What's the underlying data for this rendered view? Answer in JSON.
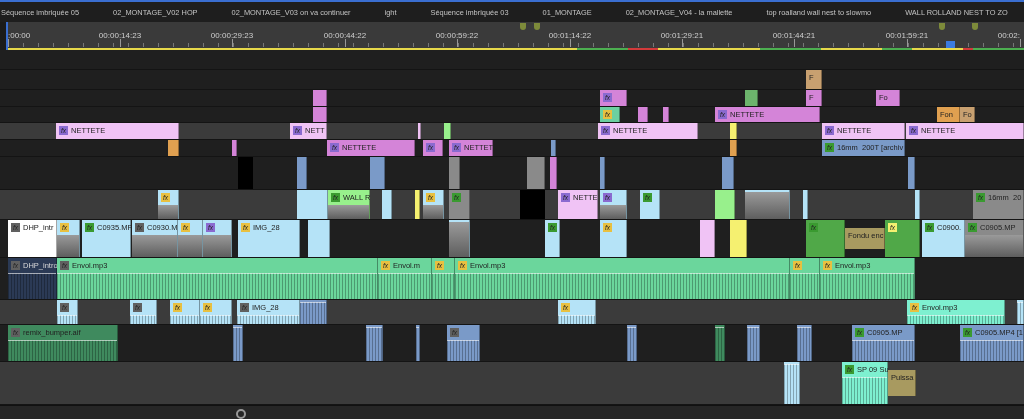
{
  "tabs": [
    {
      "label": "Séquence imbriquée 05",
      "selected": false
    },
    {
      "label": "02_MONTAGE_V02 HOP",
      "selected": false
    },
    {
      "label": "02_MONTAGE_V03 on va continuer",
      "selected": false
    },
    {
      "label": "ight",
      "selected": false
    },
    {
      "label": "Séquence imbriquée 03",
      "selected": false
    },
    {
      "label": "01_MONTAGE",
      "selected": false
    },
    {
      "label": "02_MONTAGE_V04 - la mallette",
      "selected": false
    },
    {
      "label": "top roalland wall nest to slowmo",
      "selected": false
    },
    {
      "label": "WALL ROLLAND NEST TO ZO",
      "selected": false
    }
  ],
  "ruler": {
    "ticks": [
      ":00:00",
      "00:00:14:23",
      "00:00:29:23",
      "00:00:44:22",
      "00:00:59:22",
      "00:01:14:22",
      "00:01:29:21",
      "00:01:44:21",
      "00:01:59:21",
      "00:02:"
    ]
  },
  "tracks": [
    {
      "highlighted": false
    },
    {
      "highlighted": false,
      "clips": [
        {
          "color": "#c8a070",
          "label": "F"
        }
      ]
    },
    {
      "highlighted": false,
      "clips": [
        {
          "color": "#d484d8"
        },
        {
          "color": "#d484d8",
          "badge": {
            "text": "fx",
            "color": "#8a6ad0"
          }
        },
        {
          "color": "#6cb46c"
        },
        {
          "color": "#d484d8",
          "label": "F"
        },
        {
          "color": "#d484d8",
          "label": "Fo"
        }
      ]
    },
    {
      "highlighted": false,
      "clips": [
        {
          "color": "#d484d8"
        },
        {
          "color": "#6cd0a0",
          "badge": {
            "text": "fx",
            "color": "#e8c040"
          }
        },
        {
          "color": "#d484d8"
        },
        {
          "color": "#d484d8"
        },
        {
          "color": "#d484d8",
          "label": "NETTETE",
          "badge": {
            "text": "fx",
            "color": "#8a6ad0"
          }
        },
        {
          "color": "#e0a050",
          "label": "Fon"
        },
        {
          "color": "#c8a070",
          "label": "Fo"
        }
      ]
    },
    {
      "highlighted": true,
      "clips": [
        {
          "color": "#f0c3f5",
          "label": "NETTETE",
          "badge": {
            "text": "fx",
            "color": "#8a6ad0"
          }
        },
        {
          "color": "#f0c3f5",
          "label": "NETT",
          "badge": {
            "text": "fx",
            "color": "#8a6ad0"
          }
        },
        {
          "color": "#f0c3f5"
        },
        {
          "color": "#98f08c"
        },
        {
          "color": "#f0c3f5",
          "label": "NETTETE",
          "badge": {
            "text": "fx",
            "color": "#8a6ad0"
          }
        },
        {
          "color": "#f5f070"
        },
        {
          "color": "#f0c3f5",
          "label": "NETTETE",
          "badge": {
            "text": "fx",
            "color": "#8a6ad0"
          }
        },
        {
          "color": "#f0c3f5",
          "label": "NETTETE",
          "badge": {
            "text": "fx",
            "color": "#8a6ad0"
          }
        }
      ]
    },
    {
      "highlighted": false,
      "clips": [
        {
          "color": "#e0a050"
        },
        {
          "color": "#d484d8"
        },
        {
          "color": "#d484d8",
          "label": "NETTETE",
          "badge": {
            "text": "fx",
            "color": "#8a6ad0"
          }
        },
        {
          "color": "#d484d8",
          "badge": {
            "text": "fx",
            "color": "#8a6ad0"
          }
        },
        {
          "color": "#d484d8",
          "label": "NETTET",
          "badge": {
            "text": "fx",
            "color": "#8a6ad0"
          }
        },
        {
          "color": "#7a9ac8"
        },
        {
          "color": "#e0a050"
        },
        {
          "color": "#7a9ac8",
          "label": "16mm  200T [archiv",
          "badge": {
            "text": "fx",
            "color": "#3a9a30"
          }
        }
      ]
    },
    {
      "highlighted": false,
      "clips": [
        {
          "color": "#000000"
        },
        {
          "color": "#7a9ac8"
        },
        {
          "color": "#7a9ac8"
        },
        {
          "color": "#8a8a8a"
        },
        {
          "color": "#8a8a8a"
        },
        {
          "color": "#d484d8"
        },
        {
          "color": "#7a9ac8"
        },
        {
          "color": "#7a9ac8"
        },
        {
          "color": "#7a9ac8"
        }
      ]
    },
    {
      "highlighted": true,
      "clips": [
        {
          "color": "#b5e3f7",
          "badge": {
            "text": "fx",
            "color": "#e8c040"
          },
          "kind": "thumb"
        },
        {
          "color": "#b5e3f7"
        },
        {
          "color": "#98f08c",
          "label": "WALL R",
          "badge": {
            "text": "fx",
            "color": "#3a9a30"
          },
          "kind": "thumb"
        },
        {
          "color": "#b5e3f7"
        },
        {
          "color": "#f5f070"
        },
        {
          "color": "#b5e3f7",
          "badge": {
            "text": "fx",
            "color": "#e8c040"
          },
          "kind": "thumb"
        },
        {
          "color": "#8a8a8a",
          "badge": {
            "text": "fx",
            "color": "#3a9a30"
          }
        },
        {
          "color": "#000000"
        },
        {
          "color": "#f0c3f5",
          "label": "NETTE",
          "badge": {
            "text": "fx",
            "color": "#8a6ad0"
          }
        },
        {
          "color": "#b5e3f7",
          "badge": {
            "text": "fx",
            "color": "#8a6ad0"
          },
          "kind": "thumb"
        },
        {
          "color": "#b5e3f7",
          "badge": {
            "text": "fx",
            "color": "#3a9a30"
          }
        },
        {
          "color": "#98f08c"
        },
        {
          "color": "#b5e3f7",
          "kind": "thumb"
        },
        {
          "color": "#b5e3f7"
        },
        {
          "color": "#b5e3f7"
        },
        {
          "color": "#8a8a8a",
          "label": "16mm  20",
          "badge": {
            "text": "fx",
            "color": "#3a9a30"
          }
        }
      ]
    },
    {
      "highlighted": false,
      "clips": [
        {
          "color": "#ffffff",
          "label": "DHP_intr",
          "badge": {
            "text": "fx",
            "color": "#606060"
          }
        },
        {
          "color": "#b5e3f7",
          "badge": {
            "text": "fx",
            "color": "#e8c040"
          },
          "kind": "thumb"
        },
        {
          "color": "#b5e3f7",
          "label": "C0935.MP",
          "badge": {
            "text": "fx",
            "color": "#3a9a30"
          }
        },
        {
          "color": "#b5e3f7",
          "label": "C0930.M",
          "badge": {
            "text": "fx",
            "color": "#606060"
          },
          "kind": "thumb"
        },
        {
          "color": "#b5e3f7",
          "badge": {
            "text": "fx",
            "color": "#e8c040"
          },
          "kind": "thumb"
        },
        {
          "color": "#b5e3f7",
          "badge": {
            "text": "fx",
            "color": "#8a6ad0"
          },
          "kind": "thumb"
        },
        {
          "color": "#b5e3f7",
          "label": "IMG_28",
          "badge": {
            "text": "fx",
            "color": "#e8c040"
          }
        },
        {
          "color": "#b5e3f7"
        },
        {
          "color": "#b5e3f7",
          "kind": "thumb"
        },
        {
          "color": "#b5e3f7",
          "badge": {
            "text": "fx",
            "color": "#3a9a30"
          }
        },
        {
          "color": "#b5e3f7",
          "badge": {
            "text": "fx",
            "color": "#e8c040"
          }
        },
        {
          "color": "#f0c3f5"
        },
        {
          "color": "#f5f070"
        },
        {
          "color": "#50a848",
          "badge": {
            "text": "fx",
            "color": "#3a9a30"
          }
        },
        {
          "color": "#a89a60",
          "label": "Fondu enc",
          "kind": "transition"
        },
        {
          "color": "#50a848",
          "badge": {
            "text": "fx",
            "color": "#f5f070"
          }
        },
        {
          "color": "#b5e3f7",
          "label": "C0900.",
          "badge": {
            "text": "fx",
            "color": "#3a9a30"
          }
        },
        {
          "color": "#8a8a8a",
          "label": "C0905.MP",
          "badge": {
            "text": "fx",
            "color": "#3a9a30"
          },
          "kind": "thumb"
        }
      ]
    },
    {
      "highlighted": false,
      "clips": [
        {
          "color": "#2b3a55",
          "label": "DHP_intro",
          "badge": {
            "text": "fx",
            "color": "#606060"
          },
          "kind": "wave"
        },
        {
          "color": "#6bd69c",
          "label": "Envol.mp3",
          "badge": {
            "text": "fx",
            "color": "#606060"
          },
          "kind": "wave"
        },
        {
          "color": "#6bd69c",
          "label": "Envol.m",
          "badge": {
            "text": "fx",
            "color": "#e8c040"
          },
          "kind": "wave"
        },
        {
          "color": "#6bd69c",
          "badge": {
            "text": "fx",
            "color": "#e8c040"
          },
          "kind": "wave"
        },
        {
          "color": "#6bd69c",
          "label": "Envol.mp3",
          "badge": {
            "text": "fx",
            "color": "#e8c040"
          },
          "kind": "wave"
        },
        {
          "color": "#6bd69c",
          "badge": {
            "text": "fx",
            "color": "#e8c040"
          },
          "kind": "wave"
        },
        {
          "color": "#6bd69c",
          "label": "Envol.mp3",
          "badge": {
            "text": "fx",
            "color": "#e8c040"
          },
          "kind": "wave"
        }
      ]
    },
    {
      "highlighted": true,
      "clips": [
        {
          "color": "#b5e3f7",
          "badge": {
            "text": "fx",
            "color": "#606060"
          },
          "kind": "wave"
        },
        {
          "color": "#b5e3f7",
          "badge": {
            "text": "fx",
            "color": "#606060"
          },
          "kind": "wave"
        },
        {
          "color": "#b5e3f7",
          "badge": {
            "text": "fx",
            "color": "#e8c040"
          },
          "kind": "wave"
        },
        {
          "color": "#b5e3f7",
          "badge": {
            "text": "fx",
            "color": "#e8c040"
          },
          "kind": "wave"
        },
        {
          "color": "#b5e3f7",
          "label": "IMG_28",
          "badge": {
            "text": "fx",
            "color": "#606060"
          },
          "kind": "wave"
        },
        {
          "color": "#7a9ac8",
          "kind": "wave"
        },
        {
          "color": "#b5e3f7",
          "badge": {
            "text": "fx",
            "color": "#e8c040"
          },
          "kind": "wave"
        },
        {
          "color": "#7ef0d0",
          "label": "Envol.mp3",
          "badge": {
            "text": "fx",
            "color": "#e8c040"
          },
          "kind": "wave"
        },
        {
          "color": "#b5e3f7",
          "kind": "wave"
        }
      ]
    },
    {
      "highlighted": false,
      "clips": [
        {
          "color": "#3f8a5e",
          "label": "remix_bumper.aif",
          "badge": {
            "text": "fx",
            "color": "#606060"
          },
          "kind": "wave"
        },
        {
          "color": "#7a9ac8",
          "kind": "wave"
        },
        {
          "color": "#7a9ac8",
          "kind": "wave"
        },
        {
          "color": "#7a9ac8",
          "kind": "wave"
        },
        {
          "color": "#7a9ac8",
          "badge": {
            "text": "fx",
            "color": "#606060"
          },
          "kind": "wave"
        },
        {
          "color": "#7a9ac8",
          "kind": "wave"
        },
        {
          "color": "#3f8a5e",
          "kind": "wave"
        },
        {
          "color": "#7a9ac8",
          "kind": "wave"
        },
        {
          "color": "#7a9ac8",
          "kind": "wave"
        },
        {
          "color": "#7a9ac8",
          "label": "C0905.MP",
          "badge": {
            "text": "fx",
            "color": "#3a9a30"
          },
          "kind": "wave"
        },
        {
          "color": "#7a9ac8",
          "label": "C0905.MP4 [1",
          "badge": {
            "text": "fx",
            "color": "#3a9a30"
          },
          "kind": "wave"
        }
      ]
    },
    {
      "highlighted": true,
      "clips": [
        {
          "color": "#b5e3f7",
          "kind": "wave"
        },
        {
          "color": "#7ef0d0",
          "label": "SP 09 Su",
          "badge": {
            "text": "fx",
            "color": "#3a9a30"
          },
          "kind": "wave"
        },
        {
          "color": "#a89a60",
          "label": "Puissa",
          "kind": "effect"
        }
      ]
    }
  ]
}
